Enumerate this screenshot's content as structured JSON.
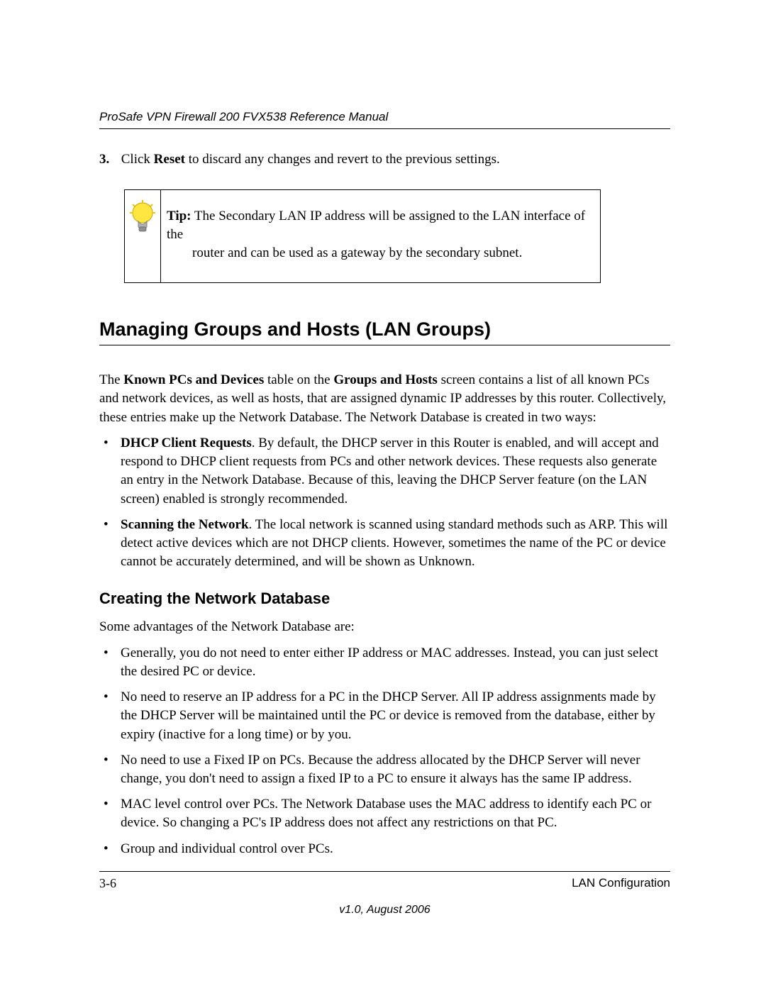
{
  "header": {
    "running_title": "ProSafe VPN Firewall 200 FVX538 Reference Manual"
  },
  "step": {
    "number": "3.",
    "pre": "Click ",
    "bold": "Reset",
    "post": " to discard any changes and revert to the previous settings."
  },
  "tip": {
    "label": "Tip:",
    "line1_rest": " The Secondary LAN IP address will be assigned to the LAN interface of the",
    "line2": "router and can be used as a gateway by the secondary subnet."
  },
  "section": {
    "heading": "Managing Groups and Hosts (LAN Groups)",
    "intro_pre": "The ",
    "intro_b1": "Known PCs and Devices",
    "intro_mid1": " table on the ",
    "intro_b2": "Groups and Hosts",
    "intro_rest": " screen contains a list of all known PCs and network devices, as well as hosts, that are assigned dynamic IP addresses by this router. Collectively, these entries make up the Network Database. The Network Database is created in two ways:",
    "bullets": [
      {
        "lead": "DHCP Client Requests",
        "rest": ". By default, the DHCP server in this Router is enabled, and will accept and respond to DHCP client requests from PCs and other network devices. These requests also generate an entry in the Network Database. Because of this, leaving the DHCP Server feature (on the LAN screen) enabled is strongly recommended."
      },
      {
        "lead": "Scanning the Network",
        "rest": ". The local network is scanned using standard methods such as ARP. This will detect active devices which are not DHCP clients. However, sometimes the name of the PC or device cannot be accurately determined, and will be shown as Unknown."
      }
    ]
  },
  "subsection": {
    "heading": "Creating the Network Database",
    "intro": "Some advantages of the Network Database are:",
    "bullets": [
      "Generally, you do not need to enter either IP address or MAC addresses. Instead, you can just select the desired PC or device.",
      "No need to reserve an IP address for a PC in the DHCP Server. All IP address assignments made by the DHCP Server will be maintained until the PC or device is removed from the database, either by expiry (inactive for a long time) or by you.",
      "No need to use a Fixed IP on PCs. Because the address allocated by the DHCP Server will never change, you don't need to assign a fixed IP to a PC to ensure it always has the same IP address.",
      "MAC level control over PCs. The Network Database uses the MAC address to identify each PC or device. So changing a PC's IP address does not affect any restrictions on that PC.",
      "Group and individual control over PCs."
    ]
  },
  "footer": {
    "page_number": "3-6",
    "chapter": "LAN Configuration",
    "version": "v1.0, August 2006"
  }
}
